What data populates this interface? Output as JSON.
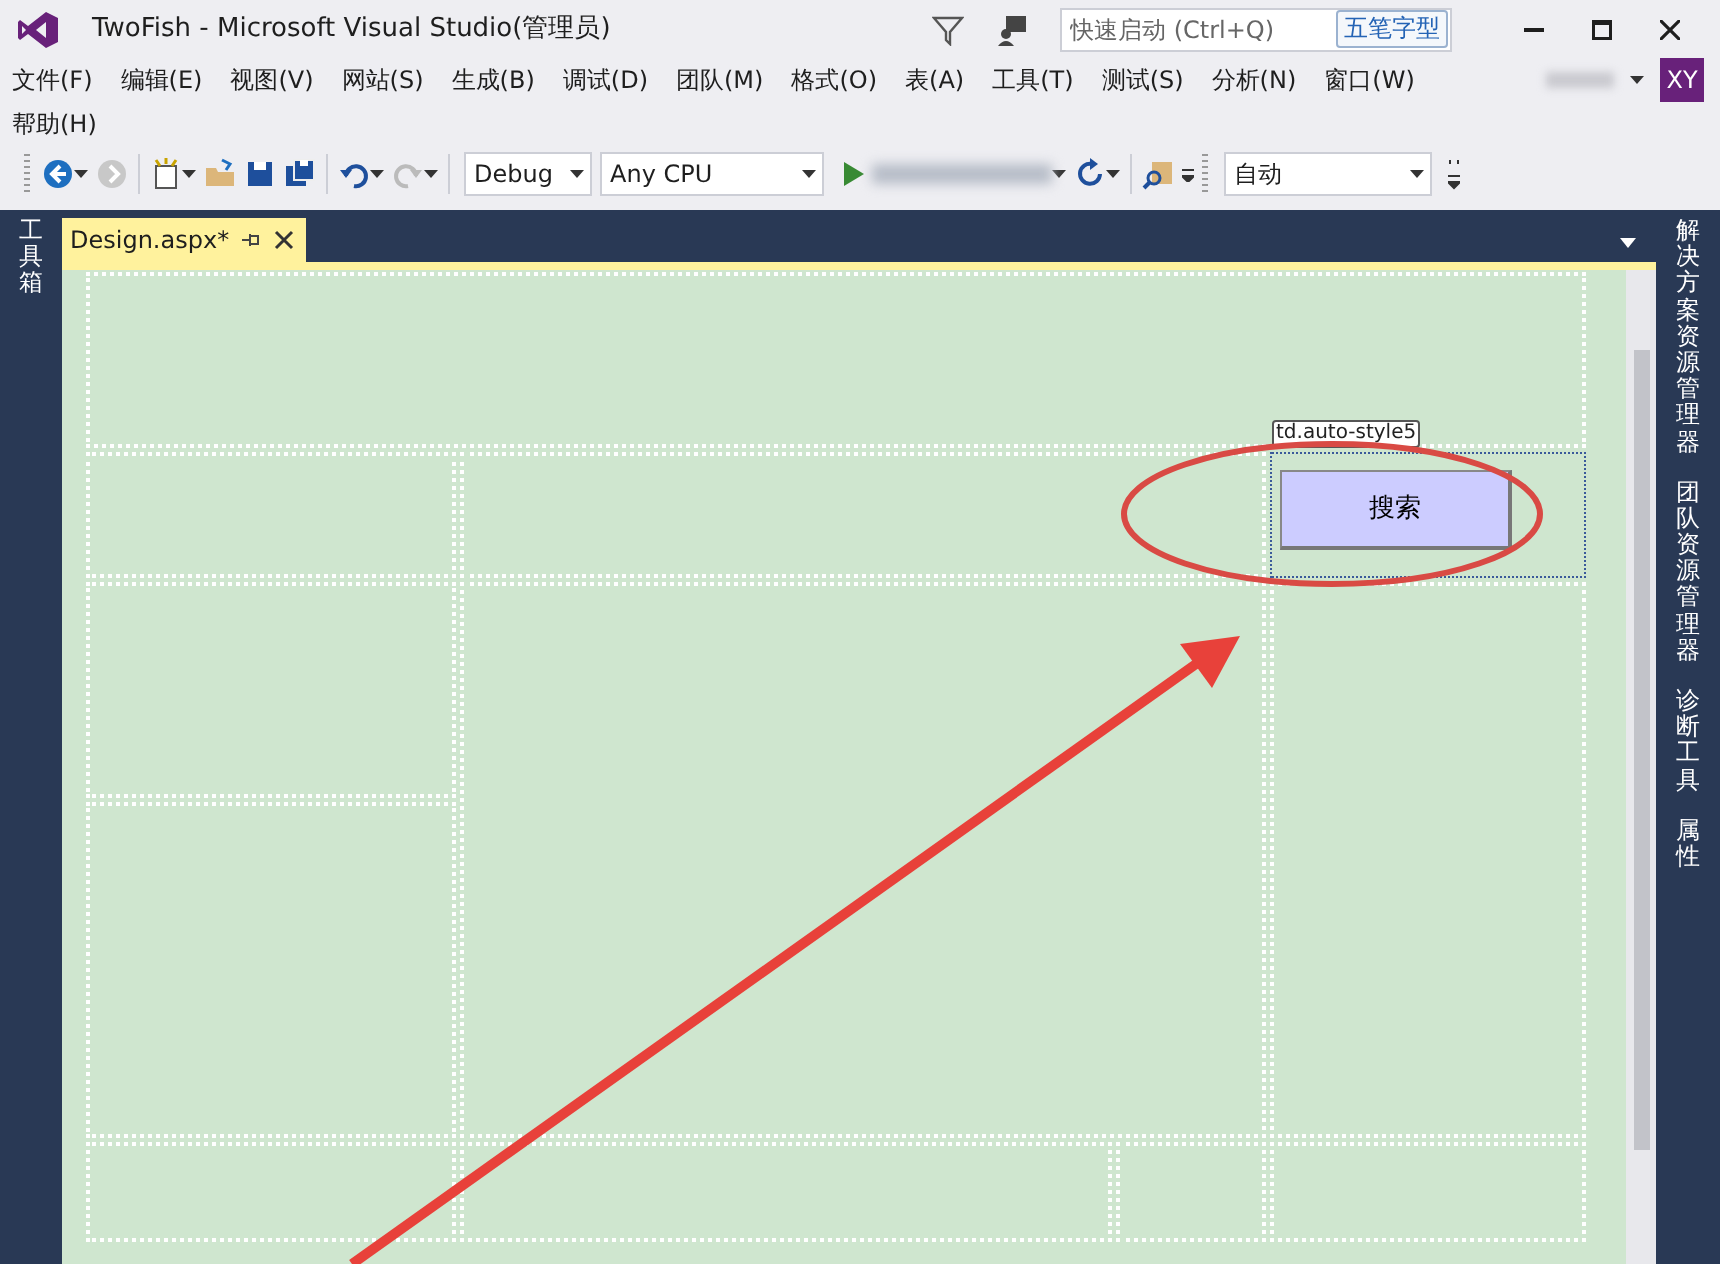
{
  "window": {
    "title": "TwoFish - Microsoft Visual Studio(管理员)"
  },
  "quick_launch": {
    "placeholder": "快速启动 (Ctrl+Q)",
    "ime_indicator": "五笔字型"
  },
  "menu": [
    "文件(F)",
    "编辑(E)",
    "视图(V)",
    "网站(S)",
    "生成(B)",
    "调试(D)",
    "团队(M)",
    "格式(O)",
    "表(A)",
    "工具(T)",
    "测试(S)",
    "分析(N)",
    "窗口(W)",
    "帮助(H)"
  ],
  "account": {
    "initials": "XY"
  },
  "toolbar": {
    "configuration": "Debug",
    "platform": "Any CPU",
    "zoom": "自动"
  },
  "left_panel": {
    "tabs": [
      "工具箱"
    ]
  },
  "document_tabs": [
    {
      "label": "Design.aspx*",
      "selected": true
    }
  ],
  "design": {
    "tag_label": "td.auto-style5",
    "button": "搜索"
  },
  "right_panel": {
    "tabs": [
      "解决方案资源管理器",
      "团队资源管理器",
      "诊断工具",
      "属性"
    ]
  }
}
